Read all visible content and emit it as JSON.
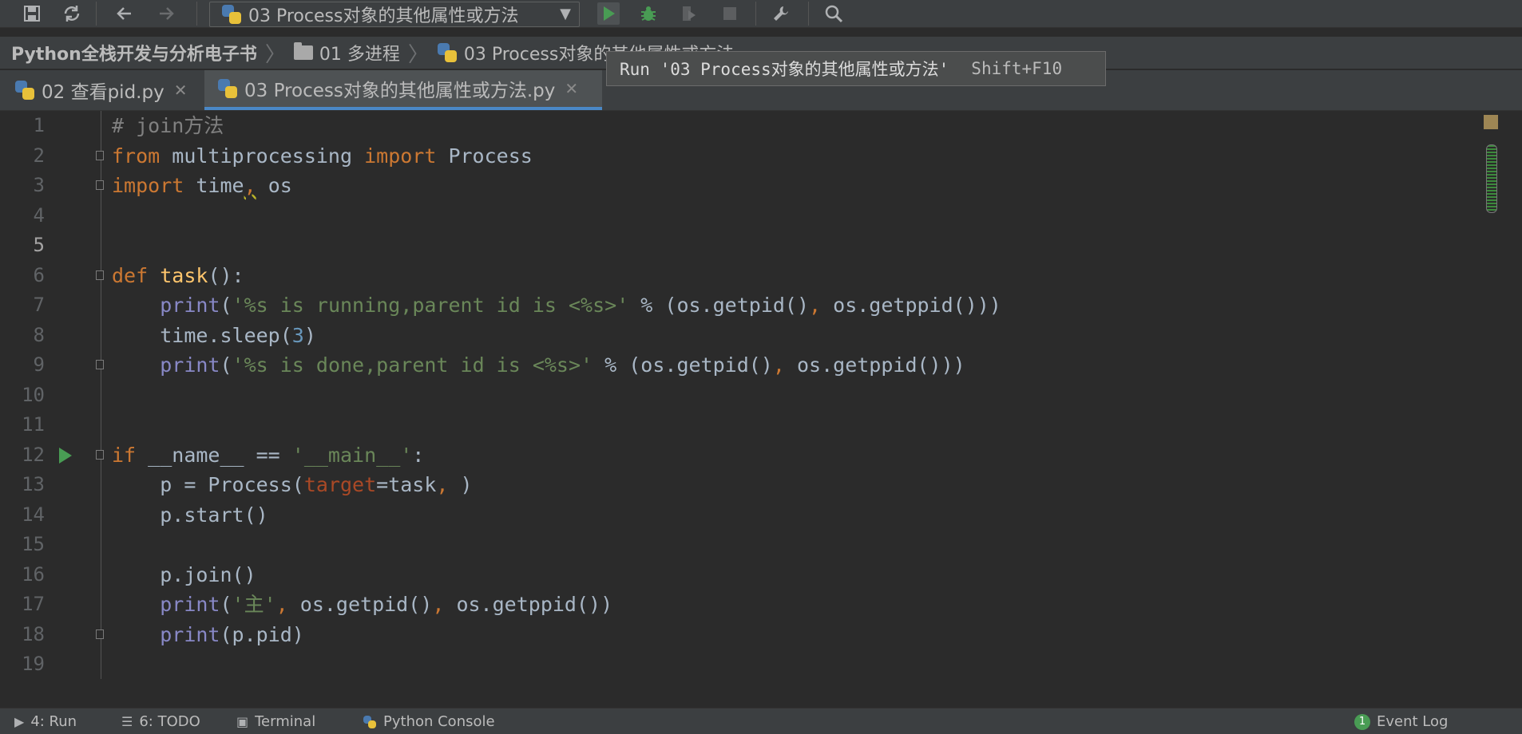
{
  "toolbar": {
    "run_config_label": "03 Process对象的其他属性或方法",
    "icons": [
      "save-icon",
      "sync-icon",
      "back-icon",
      "forward-icon",
      "run-icon",
      "debug-icon",
      "coverage-icon",
      "stop-icon",
      "wrench-icon",
      "search-icon"
    ],
    "run_color": "#499c54"
  },
  "breadcrumb": {
    "project": "Python全栈开发与分析电子书",
    "folder": "01 多进程",
    "file": "03 Process对象的其他属性或方法"
  },
  "tooltip": {
    "text": "Run '03 Process对象的其他属性或方法'",
    "shortcut": "Shift+F10"
  },
  "tabs": [
    {
      "label": "02 查看pid.py",
      "active": false
    },
    {
      "label": "03 Process对象的其他属性或方法.py",
      "active": true
    }
  ],
  "editor": {
    "line_numbers": [
      "1",
      "2",
      "3",
      "4",
      "5",
      "6",
      "7",
      "8",
      "9",
      "10",
      "11",
      "12",
      "13",
      "14",
      "15",
      "16",
      "17",
      "18",
      "19"
    ],
    "code": {
      "l1": "# join方法",
      "l2_from": "from",
      "l2_mod": " multiprocessing ",
      "l2_import": "import",
      "l2_name": " Process",
      "l3_import": "import",
      "l3_a": " time",
      "l3_comma": ",",
      "l3_b": " os",
      "l6_def": "def",
      "l6_name": "task",
      "l6_rest": "():",
      "l7_print": "print",
      "l7_open": "(",
      "l7_str": "'%s is running,parent id is <%s>'",
      "l7_mid": " % (os.getpid()",
      "l7_comma": ",",
      "l7_end": " os.getppid()))",
      "l8_a": "time.sleep(",
      "l8_num": "3",
      "l8_b": ")",
      "l9_print": "print",
      "l9_open": "(",
      "l9_str": "'%s is done,parent id is <%s>'",
      "l9_mid": " % (os.getpid()",
      "l9_comma": ",",
      "l9_end": " os.getppid()))",
      "l12_if": "if",
      "l12_mid": " __name__ == ",
      "l12_str": "'__main__'",
      "l12_end": ":",
      "l13_a": "p = Process(",
      "l13_param": "target",
      "l13_b": "=task",
      "l13_comma": ",",
      "l13_c": " )",
      "l14": "p.start()",
      "l16": "p.join()",
      "l17_print": "print",
      "l17_open": "(",
      "l17_str": "'主'",
      "l17_comma1": ",",
      "l17_mid": " os.getpid()",
      "l17_comma2": ",",
      "l17_end": " os.getppid())",
      "l18_print": "print",
      "l18_rest": "(p.pid)"
    }
  },
  "statusbar": {
    "run": "4: Run",
    "todo": "6: TODO",
    "terminal": "Terminal",
    "python_console": "Python Console",
    "event_count": "1",
    "event_log": "Event Log"
  }
}
